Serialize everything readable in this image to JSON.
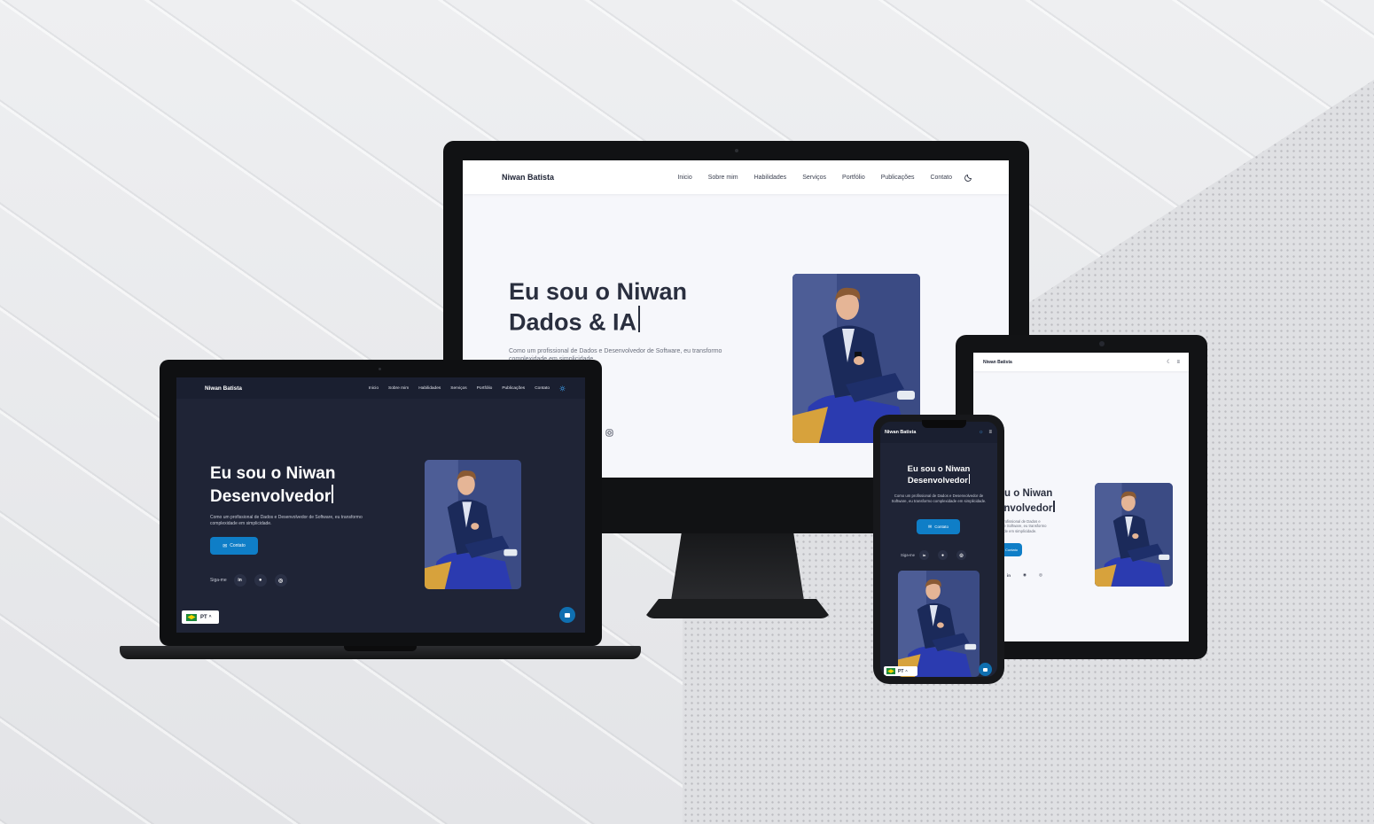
{
  "site": {
    "brand": "Niwan Batista",
    "nav": [
      "Inicio",
      "Sobre mim",
      "Habilidades",
      "Serviços",
      "Portfólio",
      "Publicações",
      "Contato"
    ],
    "hero_prefix": "Eu sou o Niwan",
    "typed_monitor": "Dados & IA",
    "typed_dark": "Desenvolvedor",
    "hero_tablet_prefix": "ou o Niwan",
    "typed_tablet": "envolvedor",
    "description": "Como um profissional de Dados e Desenvolvedor de Software, eu transformo complexidade em simplicidade.",
    "description_tablet": "profissional de Dados e\nde Software, eu transformo\nade em simplicidade.",
    "contact_button": "Contato",
    "follow_label": "Siga-me",
    "language": "PT"
  },
  "icons": [
    "moon-icon",
    "sun-icon",
    "menu-icon",
    "linkedin-icon",
    "github-icon",
    "instagram-icon",
    "mail-icon",
    "chat-icon",
    "brazil-flag-icon",
    "chevron-up-icon"
  ],
  "colors": {
    "accent": "#0f7ec7",
    "dark_bg": "#1f2436",
    "light_bg": "#f6f7fb"
  }
}
